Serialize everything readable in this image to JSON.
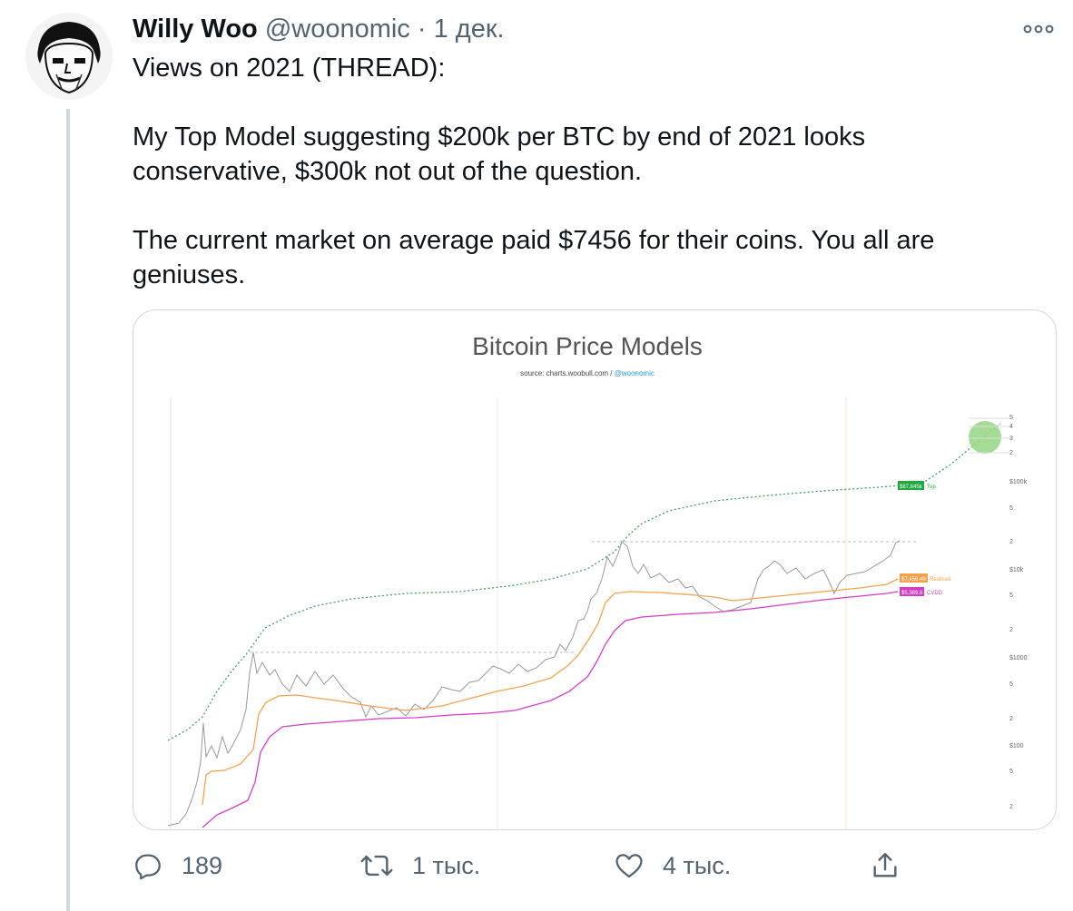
{
  "tweet": {
    "author_name": "Willy Woo",
    "author_handle": "@woonomic",
    "separator": "·",
    "date": "1 дек.",
    "lines": [
      "Views on 2021 (THREAD):",
      "My Top Model suggesting $200k per BTC by end of 2021 looks",
      "conservative, $300k not out of the question.",
      "The current market on average paid $7456 for their coins. You all are",
      "geniuses."
    ]
  },
  "chart": {
    "title": "Bitcoin Price Models",
    "source_prefix": "source: charts.woobull.com / ",
    "source_handle": "@woonomic",
    "y_ticks": [
      "$100k",
      "5",
      "2",
      "$10k",
      "5",
      "2",
      "$1000",
      "5",
      "2",
      "$100",
      "5",
      "2"
    ],
    "top_ticks": [
      "5",
      "4",
      "3",
      "2"
    ],
    "labels": {
      "top": {
        "value": "$87,645k",
        "name": "Top",
        "color": "#1fa83e"
      },
      "realised": {
        "value": "$7,456.49",
        "name": "Realised",
        "color": "#f5a04a"
      },
      "cvdd": {
        "value": "$5,389.8",
        "name": "CVDD",
        "color": "#d43cc6"
      }
    },
    "colors": {
      "price": "#9a9a9a",
      "top": "#3aa55a",
      "realised": "#f7a24d",
      "cvdd": "#d63ccc",
      "circle": "#9bd88a"
    }
  },
  "actions": {
    "replies": "189",
    "retweets": "1 тыс.",
    "likes": "4 тыс."
  },
  "icons": [
    "more-icon",
    "reply-icon",
    "retweet-icon",
    "like-icon",
    "share-icon"
  ]
}
